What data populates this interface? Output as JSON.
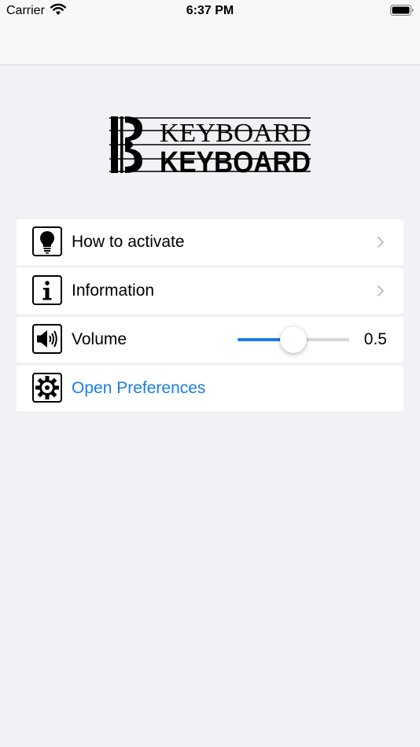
{
  "status_bar": {
    "carrier": "Carrier",
    "time": "6:37 PM"
  },
  "logo": {
    "text_top": "KEYBOARD",
    "text_bottom": "KEYBOARD"
  },
  "rows": {
    "how_to_activate": {
      "label": "How to activate",
      "icon": "lightbulb-icon"
    },
    "information": {
      "label": "Information",
      "icon": "info-icon"
    },
    "volume": {
      "label": "Volume",
      "icon": "speaker-icon",
      "value": "0.5",
      "level": 0.5
    },
    "open_preferences": {
      "label": "Open Preferences",
      "icon": "gear-icon"
    }
  },
  "colors": {
    "accent": "#1a7ee8",
    "background": "#f1f1f6",
    "row_background": "#ffffff"
  }
}
